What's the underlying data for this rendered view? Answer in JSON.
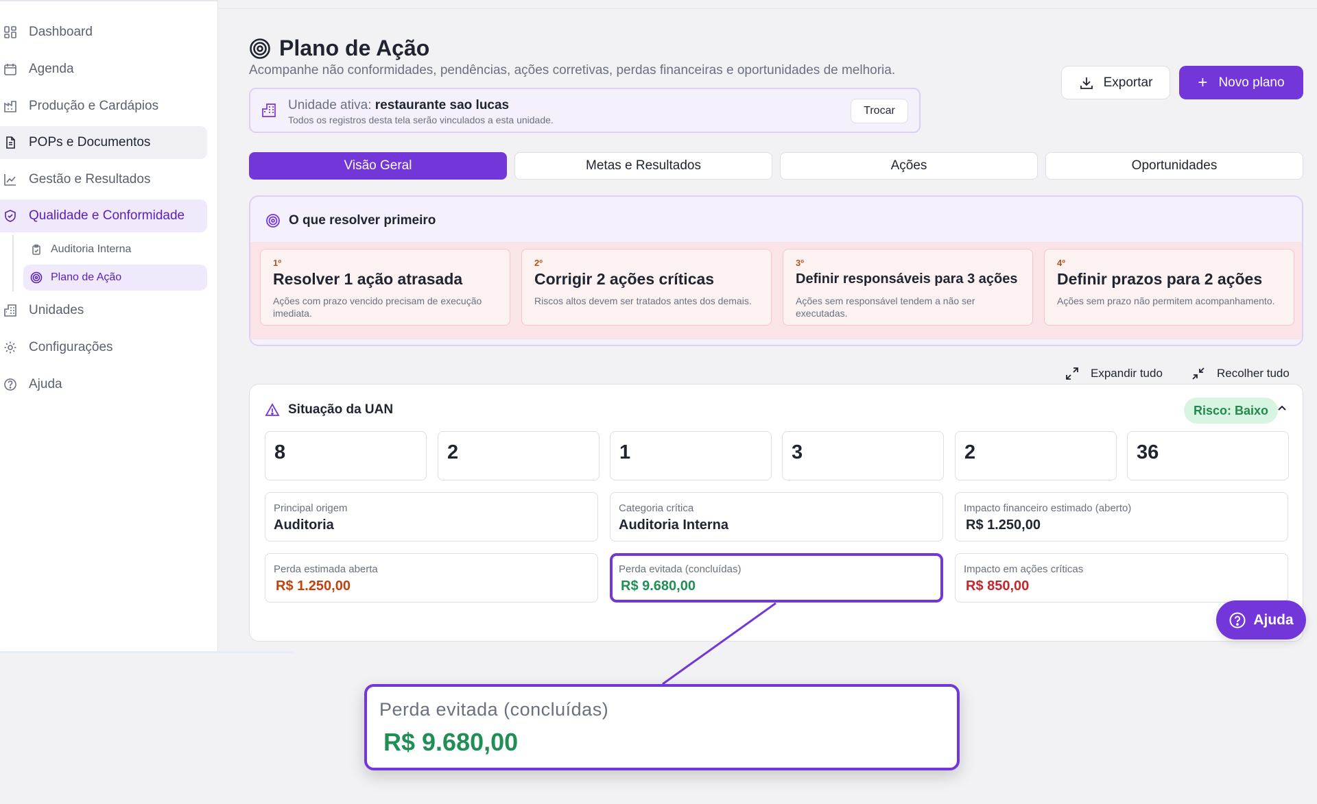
{
  "sidebar": {
    "items": [
      {
        "label": "Dashboard",
        "icon": "dashboard-icon"
      },
      {
        "label": "Agenda",
        "icon": "calendar-icon"
      },
      {
        "label": "Produção e Cardápios",
        "icon": "factory-icon"
      },
      {
        "label": "POPs e Documentos",
        "icon": "document-icon"
      },
      {
        "label": "Gestão e Resultados",
        "icon": "line-chart-icon"
      },
      {
        "label": "Qualidade e Conformidade",
        "icon": "shield-check-icon"
      },
      {
        "label": "Unidades",
        "icon": "building-icon"
      },
      {
        "label": "Configurações",
        "icon": "gear-icon"
      },
      {
        "label": "Ajuda",
        "icon": "help-circle-icon"
      }
    ],
    "subitems": [
      {
        "label": "Auditoria Interna",
        "icon": "clipboard-check-icon"
      },
      {
        "label": "Plano de Ação",
        "icon": "target-icon"
      }
    ]
  },
  "header": {
    "title": "Plano de Ação",
    "subtitle": "Acompanhe não conformidades, pendências, ações corretivas, perdas financeiras e oportunidades de melhoria.",
    "export_label": "Exportar",
    "new_label": "Novo plano"
  },
  "unit": {
    "prefix": "Unidade ativa:",
    "name": "restaurante sao lucas",
    "note": "Todos os registros desta tela serão vinculados a esta unidade.",
    "change_label": "Trocar"
  },
  "tabs": [
    "Visão Geral",
    "Metas e Resultados",
    "Ações",
    "Oportunidades"
  ],
  "priorities": {
    "title": "O que resolver primeiro",
    "cards": [
      {
        "rank": "1º",
        "title": "Resolver 1 ação atrasada",
        "desc": "Ações com prazo vencido precisam de execução imediata."
      },
      {
        "rank": "2º",
        "title": "Corrigir 2 ações críticas",
        "desc": "Riscos altos devem ser tratados antes dos demais."
      },
      {
        "rank": "3º",
        "title": "Definir responsáveis para 3 ações",
        "desc": "Ações sem responsável tendem a não ser executadas."
      },
      {
        "rank": "4º",
        "title": "Definir prazos para 2 ações",
        "desc": "Ações sem prazo não permitem acompanhamento."
      }
    ]
  },
  "controls": {
    "expand_label": "Expandir tudo",
    "collapse_label": "Recolher tudo"
  },
  "uan": {
    "title": "Situação da UAN",
    "risk_label": "Risco: Baixo",
    "stats": [
      "8",
      "2",
      "1",
      "3",
      "2",
      "36"
    ],
    "info": [
      {
        "label": "Principal origem",
        "value": "Auditoria"
      },
      {
        "label": "Categoria crítica",
        "value": "Auditoria Interna"
      },
      {
        "label": "Impacto financeiro estimado (aberto)",
        "value": "R$ 1.250,00"
      },
      {
        "label": "Perda estimada aberta",
        "value": "R$ 1.250,00"
      },
      {
        "label": "Perda evitada (concluídas)",
        "value": "R$ 9.680,00"
      },
      {
        "label": "Impacto em ações críticas",
        "value": "R$ 850,00"
      }
    ]
  },
  "help_label": "Ajuda",
  "callout": {
    "label": "Perda evitada (concluídas)",
    "value": "R$ 9.680,00"
  },
  "colors": {
    "accent": "#7337d9",
    "risk_bg": "#d8f5e2",
    "risk_text": "#1f8a4c",
    "value_orange": "#c2410c",
    "value_green": "#218f55",
    "value_red": "#c3272d"
  }
}
